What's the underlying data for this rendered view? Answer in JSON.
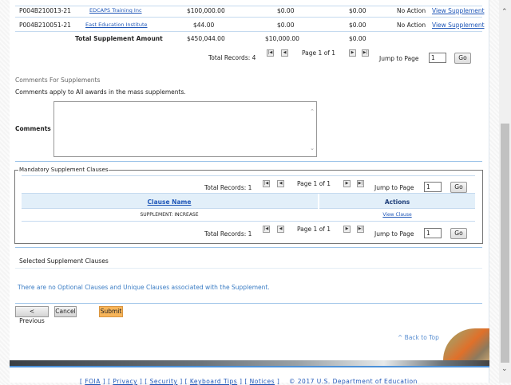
{
  "supplements": {
    "rows": [
      {
        "award": "P004B210013-21",
        "org": "EDCAPS Training Inc",
        "amount": "$100,000.00",
        "col2": "$0.00",
        "col3": "$0.00",
        "status": "No Action",
        "action": "View Supplement"
      },
      {
        "award": "P004B210051-21",
        "org": "East Education Institute",
        "amount": "$44.00",
        "col2": "$0.00",
        "col3": "$0.00",
        "status": "No Action",
        "action": "View Supplement"
      }
    ],
    "total": {
      "label": "Total Supplement Amount",
      "amount": "$450,044.00",
      "col2": "$10,000.00",
      "col3": "$0.00"
    },
    "pager": {
      "total": "Total Records: 4",
      "page": "Page 1 of 1",
      "jump": "Jump to Page",
      "value": "1",
      "go": "Go"
    }
  },
  "comments": {
    "section": "Comments For Supplements",
    "note": "Comments apply to All awards in the mass supplements.",
    "label": "Comments",
    "value": ""
  },
  "mandatory": {
    "legend": "Mandatory Supplement Clauses",
    "pager": {
      "total": "Total Records: 1",
      "page": "Page 1 of 1",
      "jump": "Jump to Page",
      "value": "1",
      "go": "Go"
    },
    "headers": [
      "Clause Name",
      "Actions"
    ],
    "rows": [
      {
        "name": "SUPPLEMENT: INCREASE",
        "action": "View Clause"
      }
    ]
  },
  "selected": {
    "legend": "Selected Supplement Clauses",
    "message": "There are no Optional Clauses and Unique Clauses associated with the Supplement."
  },
  "buttons": {
    "previous": "< Previous",
    "cancel": "Cancel",
    "submit": "Submit"
  },
  "back_to_top": "^ Back to Top",
  "footer": {
    "links": [
      "FOIA",
      "Privacy",
      "Security",
      "Keyboard Tips",
      "Notices"
    ],
    "copyright": "© 2017 U.S. Department of Education"
  },
  "colors": {
    "accent": "#1f57b8",
    "submit": "#f7b55a",
    "header_bg": "#e2eff9"
  }
}
